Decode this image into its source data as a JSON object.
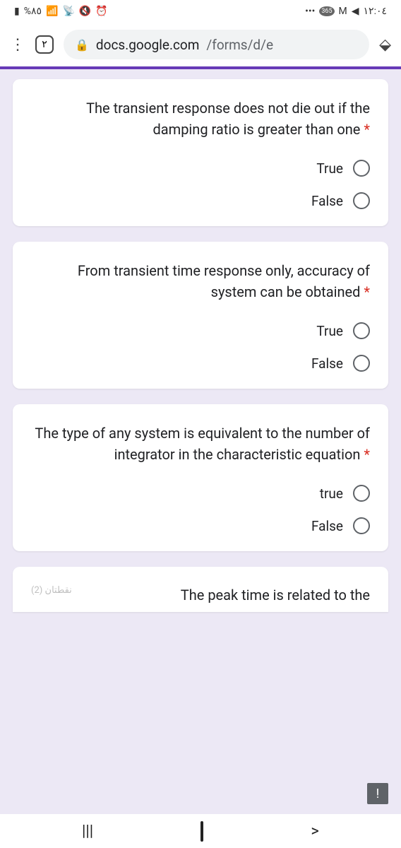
{
  "status": {
    "battery": "%٨٥",
    "time": "١٢:٠٤",
    "signal_icons": "⦿",
    "badge_365": "365"
  },
  "browser": {
    "tab_count": "٢",
    "url_host": "docs.google.com",
    "url_path": "/forms/d/e"
  },
  "questions": [
    {
      "text": "The transient response does not die out if the damping ratio is greater than one",
      "required": "*",
      "options": [
        "True",
        "False"
      ]
    },
    {
      "text": "From transient time response only, accuracy of system can be obtained",
      "required": "*",
      "options": [
        "True",
        "False"
      ]
    },
    {
      "text": "The type of any system is equivalent to the number of integrator in the characteristic equation",
      "required": "*",
      "options": [
        "true",
        "False"
      ]
    }
  ],
  "cut_question": {
    "points_label": "(2) نقطتان",
    "text": "The peak time is related to the"
  },
  "nav": {
    "recent": "|||",
    "back": ">"
  }
}
